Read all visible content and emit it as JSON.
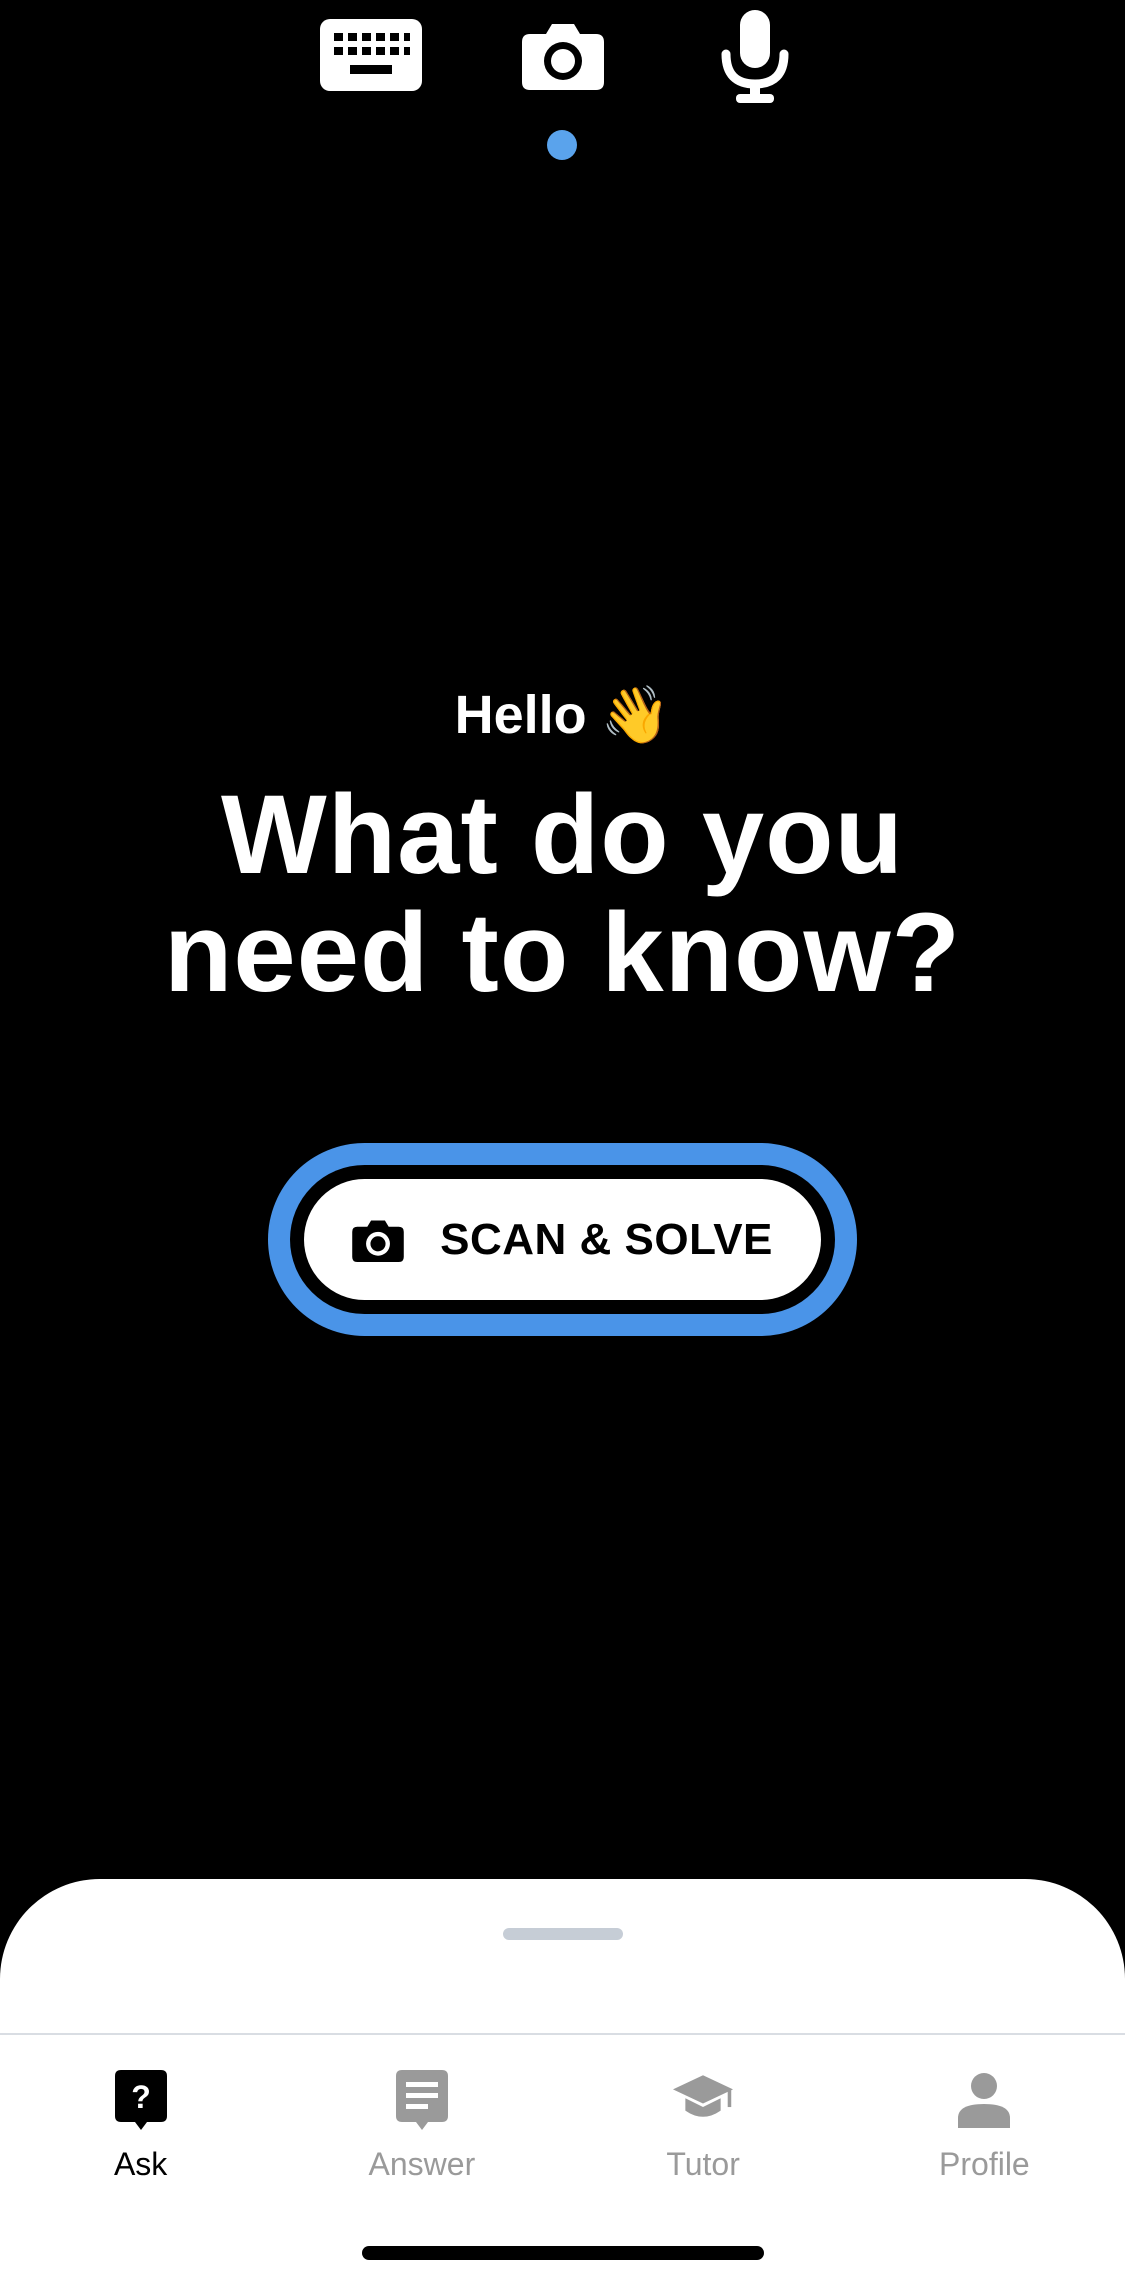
{
  "mode_switcher": {
    "items": [
      {
        "icon": "keyboard-icon"
      },
      {
        "icon": "camera-icon",
        "selected": true
      },
      {
        "icon": "microphone-icon"
      }
    ],
    "indicator_color": "#5aa3ec"
  },
  "hero": {
    "greeting": "Hello",
    "greeting_emoji": "👋",
    "headline": "What do you need to know?"
  },
  "cta": {
    "label": "SCAN & SOLVE",
    "icon": "camera-icon",
    "ring_color": "#4a94e8"
  },
  "tabbar": {
    "tabs": [
      {
        "label": "Ask",
        "icon": "question-bubble-icon",
        "active": true
      },
      {
        "label": "Answer",
        "icon": "answer-bubble-icon",
        "active": false
      },
      {
        "label": "Tutor",
        "icon": "graduation-cap-icon",
        "active": false
      },
      {
        "label": "Profile",
        "icon": "person-icon",
        "active": false
      }
    ]
  }
}
